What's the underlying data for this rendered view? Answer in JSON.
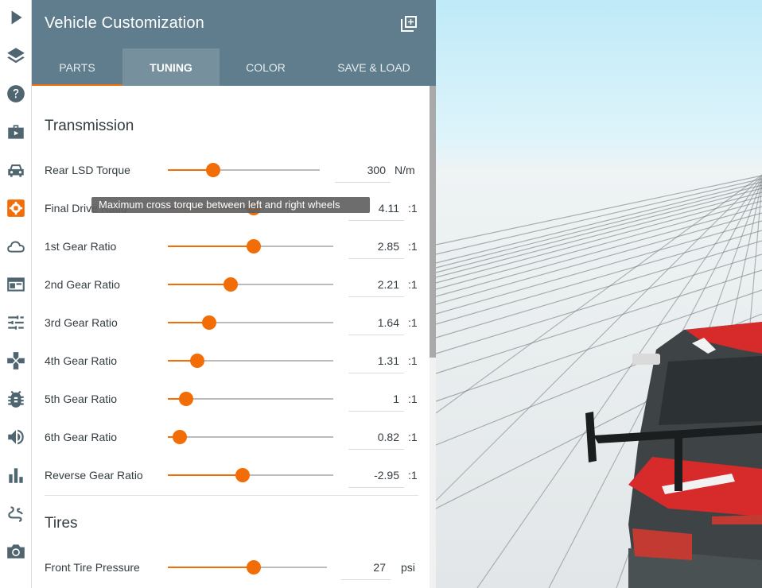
{
  "panel": {
    "title": "Vehicle Customization",
    "tabs": [
      {
        "label": "PARTS",
        "active": false
      },
      {
        "label": "TUNING",
        "active": true
      },
      {
        "label": "COLOR",
        "active": false
      },
      {
        "label": "SAVE & LOAD",
        "active": false
      }
    ]
  },
  "toolbar": {
    "items": [
      {
        "name": "play-icon",
        "active": false
      },
      {
        "name": "layers-icon",
        "active": false
      },
      {
        "name": "help-icon",
        "active": false
      },
      {
        "name": "briefcase-icon",
        "active": false
      },
      {
        "name": "car-icon",
        "active": false
      },
      {
        "name": "gear-icon",
        "active": true
      },
      {
        "name": "cloud-icon",
        "active": false
      },
      {
        "name": "window-icon",
        "active": false
      },
      {
        "name": "sliders-icon",
        "active": false
      },
      {
        "name": "gamepad-icon",
        "active": false
      },
      {
        "name": "bug-icon",
        "active": false
      },
      {
        "name": "volume-icon",
        "active": false
      },
      {
        "name": "bar-chart-icon",
        "active": false
      },
      {
        "name": "route-icon",
        "active": false
      },
      {
        "name": "camera-icon",
        "active": false
      }
    ]
  },
  "transmission": {
    "title": "Transmission",
    "rows": [
      {
        "label": "Rear LSD Torque",
        "value": "300",
        "unit": "N/m",
        "level": 0.3
      },
      {
        "label": "Final Drive Ratio",
        "value": "4.11",
        "unit": ":1",
        "level": 0.52
      },
      {
        "label": "1st Gear Ratio",
        "value": "2.85",
        "unit": ":1",
        "level": 0.52
      },
      {
        "label": "2nd Gear Ratio",
        "value": "2.21",
        "unit": ":1",
        "level": 0.38
      },
      {
        "label": "3rd Gear Ratio",
        "value": "1.64",
        "unit": ":1",
        "level": 0.25
      },
      {
        "label": "4th Gear Ratio",
        "value": "1.31",
        "unit": ":1",
        "level": 0.18
      },
      {
        "label": "5th Gear Ratio",
        "value": "1",
        "unit": ":1",
        "level": 0.11
      },
      {
        "label": "6th Gear Ratio",
        "value": "0.82",
        "unit": ":1",
        "level": 0.07
      },
      {
        "label": "Reverse Gear Ratio",
        "value": "-2.95",
        "unit": ":1",
        "level": 0.45
      }
    ]
  },
  "tires": {
    "title": "Tires",
    "rows": [
      {
        "label": "Front Tire Pressure",
        "value": "27",
        "unit": "psi",
        "level": 0.54
      }
    ]
  },
  "tooltip": {
    "text": "Maximum cross torque between left and right wheels"
  },
  "colors": {
    "accent": "#f36d06",
    "header": "#5f7d8c",
    "active_tab": "#76909d",
    "icon": "#4f6570"
  }
}
